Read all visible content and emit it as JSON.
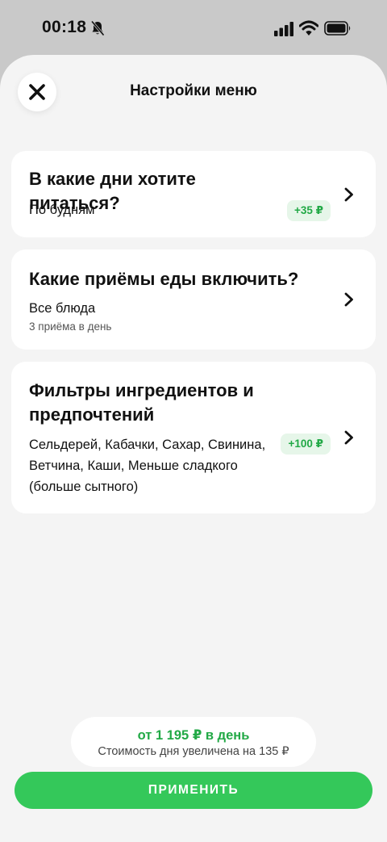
{
  "status_bar": {
    "time": "00:18",
    "icons": [
      "bell-slash-icon",
      "cellular-signal-icon",
      "wifi-icon",
      "battery-icon"
    ]
  },
  "header": {
    "title": "Настройки меню",
    "close_icon": "close-icon"
  },
  "cards": [
    {
      "title": "В какие дни хотите питаться?",
      "value": "По будням",
      "badge": "+35 ₽"
    },
    {
      "title": "Какие приёмы еды включить?",
      "value": "Все блюда",
      "subtitle": "3 приёма в день"
    },
    {
      "title": "Фильтры ингредиентов и предпочтений",
      "value": "Сельдерей, Кабачки, Сахар, Свинина, Ветчина, Каши, Меньше сладкого (больше сытного)",
      "badge": "+100 ₽"
    }
  ],
  "price": {
    "main": "от 1 195 ₽ в день",
    "note": "Стоимость дня увеличена на 135 ₽"
  },
  "apply_button": {
    "label": "ПРИМЕНИТЬ"
  },
  "colors": {
    "accent_green": "#34c85a",
    "price_green": "#22a946",
    "badge_bg": "#e6f6e9",
    "sheet_bg": "#f4f4f4",
    "backdrop": "#c9c9c9"
  }
}
